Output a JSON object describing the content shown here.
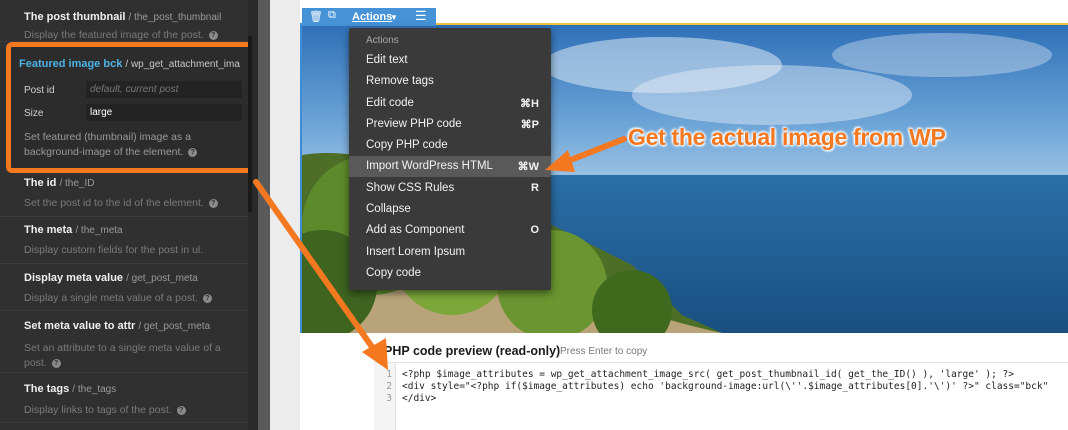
{
  "sidebar": {
    "items": [
      {
        "title": "The post thumbnail",
        "fn": "/ the_post_thumbnail",
        "desc": "Display the featured image of the post."
      },
      {
        "title": "The id",
        "fn": "/ the_ID",
        "desc": "Set the post id to the id of the element."
      },
      {
        "title": "The meta",
        "fn": "/ the_meta",
        "desc": "Display custom fields for the post in ul."
      },
      {
        "title": "Display meta value",
        "fn": "/ get_post_meta",
        "desc": "Display a single meta value of a post."
      },
      {
        "title": "Set meta value to attr",
        "fn": "/ get_post_meta",
        "desc": "Set an attribute to a single meta value of a post."
      },
      {
        "title": "The tags",
        "fn": "/ the_tags",
        "desc": "Display links to tags of the post."
      }
    ],
    "featured": {
      "title": "Featured image bck",
      "fn": "/ wp_get_attachment_ima",
      "post_id_label": "Post id",
      "post_id_placeholder": "default, current post",
      "size_label": "Size",
      "size_value": "large",
      "desc": "Set featured (thumbnail) image as a background-image of the element."
    }
  },
  "toolbar": {
    "actions_label": "Actions"
  },
  "menu": {
    "heading": "Actions",
    "items": [
      {
        "label": "Edit text",
        "key": ""
      },
      {
        "label": "Remove tags",
        "key": ""
      },
      {
        "label": "Edit code",
        "key": "⌘H"
      },
      {
        "label": "Preview PHP code",
        "key": "⌘P"
      },
      {
        "label": "Copy PHP code",
        "key": ""
      },
      {
        "label": "Import WordPress HTML",
        "key": "⌘W"
      },
      {
        "label": "Show CSS Rules",
        "key": "R"
      },
      {
        "label": "Collapse",
        "key": ""
      },
      {
        "label": "Add as Component",
        "key": "O"
      },
      {
        "label": "Insert Lorem Ipsum",
        "key": ""
      },
      {
        "label": "Copy code",
        "key": ""
      }
    ]
  },
  "callout": "Get the actual image from WP",
  "code_preview": {
    "heading": "PHP code preview (read-only)",
    "hint": "Press Enter to copy",
    "line_numbers": [
      "1",
      "2",
      "3"
    ],
    "lines": [
      "<?php $image_attributes = wp_get_attachment_image_src( get_post_thumbnail_id( get_the_ID() ), 'large' ); ?>",
      "<div style=\"<?php if($image_attributes) echo 'background-image:url(\\''.$image_attributes[0].'\\')' ?>\" class=\"bck\"",
      "</div>"
    ]
  },
  "colors": {
    "accent_orange": "#f47820",
    "toolbar_blue": "#4592d6",
    "featured_title_blue": "#4fb2e6"
  }
}
